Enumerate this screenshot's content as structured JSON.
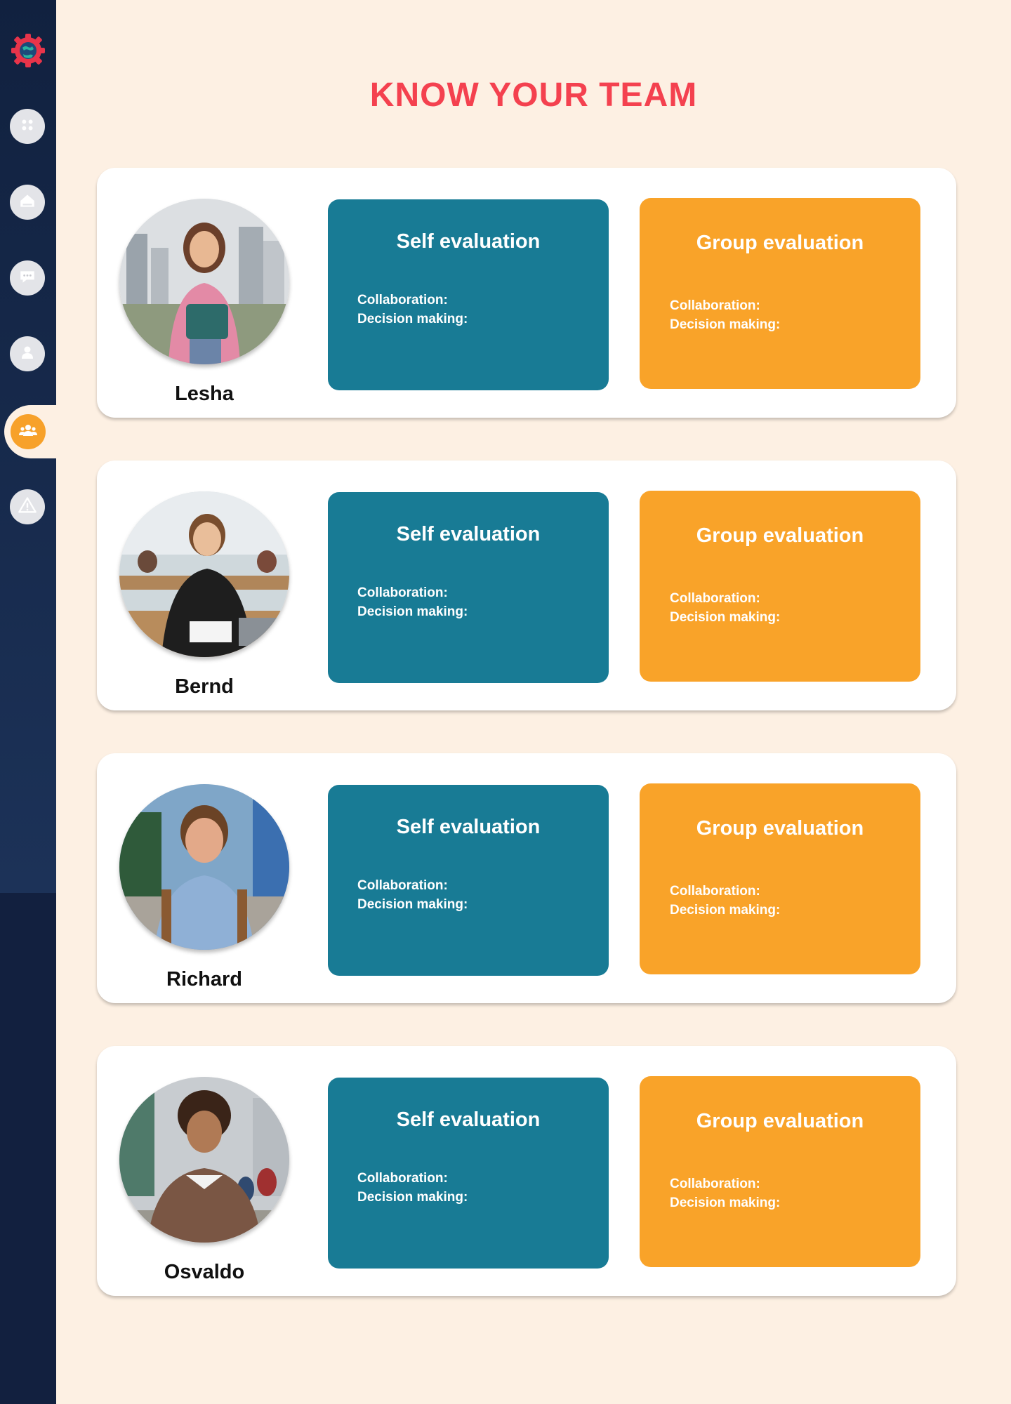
{
  "page": {
    "title": "KNOW YOUR TEAM"
  },
  "sidebar": {
    "logo_icon": "gear-globe-logo",
    "items": [
      {
        "name": "dashboard",
        "icon": "grid-icon",
        "active": false
      },
      {
        "name": "home",
        "icon": "home-icon",
        "active": false
      },
      {
        "name": "chat",
        "icon": "chat-icon",
        "active": false
      },
      {
        "name": "profile",
        "icon": "user-icon",
        "active": false
      },
      {
        "name": "team",
        "icon": "team-icon",
        "active": true
      },
      {
        "name": "alerts",
        "icon": "warning-icon",
        "active": false
      }
    ]
  },
  "colors": {
    "sidebar": "#12203f",
    "background": "#fdf0e3",
    "title": "#f4414f",
    "self_eval": "#187b95",
    "group_eval": "#f9a329",
    "active_nav": "#f7a12a"
  },
  "members": [
    {
      "name": "Lesha",
      "self": {
        "title": "Self evaluation",
        "collaboration": "Collaboration:",
        "decision": "Decision making:"
      },
      "group": {
        "title": "Group evaluation",
        "collaboration": "Collaboration:",
        "decision": "Decision making:"
      }
    },
    {
      "name": "Bernd",
      "self": {
        "title": "Self evaluation",
        "collaboration": "Collaboration:",
        "decision": "Decision making:"
      },
      "group": {
        "title": "Group evaluation",
        "collaboration": "Collaboration:",
        "decision": "Decision making:"
      }
    },
    {
      "name": "Richard",
      "self": {
        "title": "Self evaluation",
        "collaboration": "Collaboration:",
        "decision": "Decision making:"
      },
      "group": {
        "title": "Group evaluation",
        "collaboration": "Collaboration:",
        "decision": "Decision making:"
      }
    },
    {
      "name": "Osvaldo",
      "self": {
        "title": "Self evaluation",
        "collaboration": "Collaboration:",
        "decision": "Decision making:"
      },
      "group": {
        "title": "Group evaluation",
        "collaboration": "Collaboration:",
        "decision": "Decision making:"
      }
    }
  ]
}
